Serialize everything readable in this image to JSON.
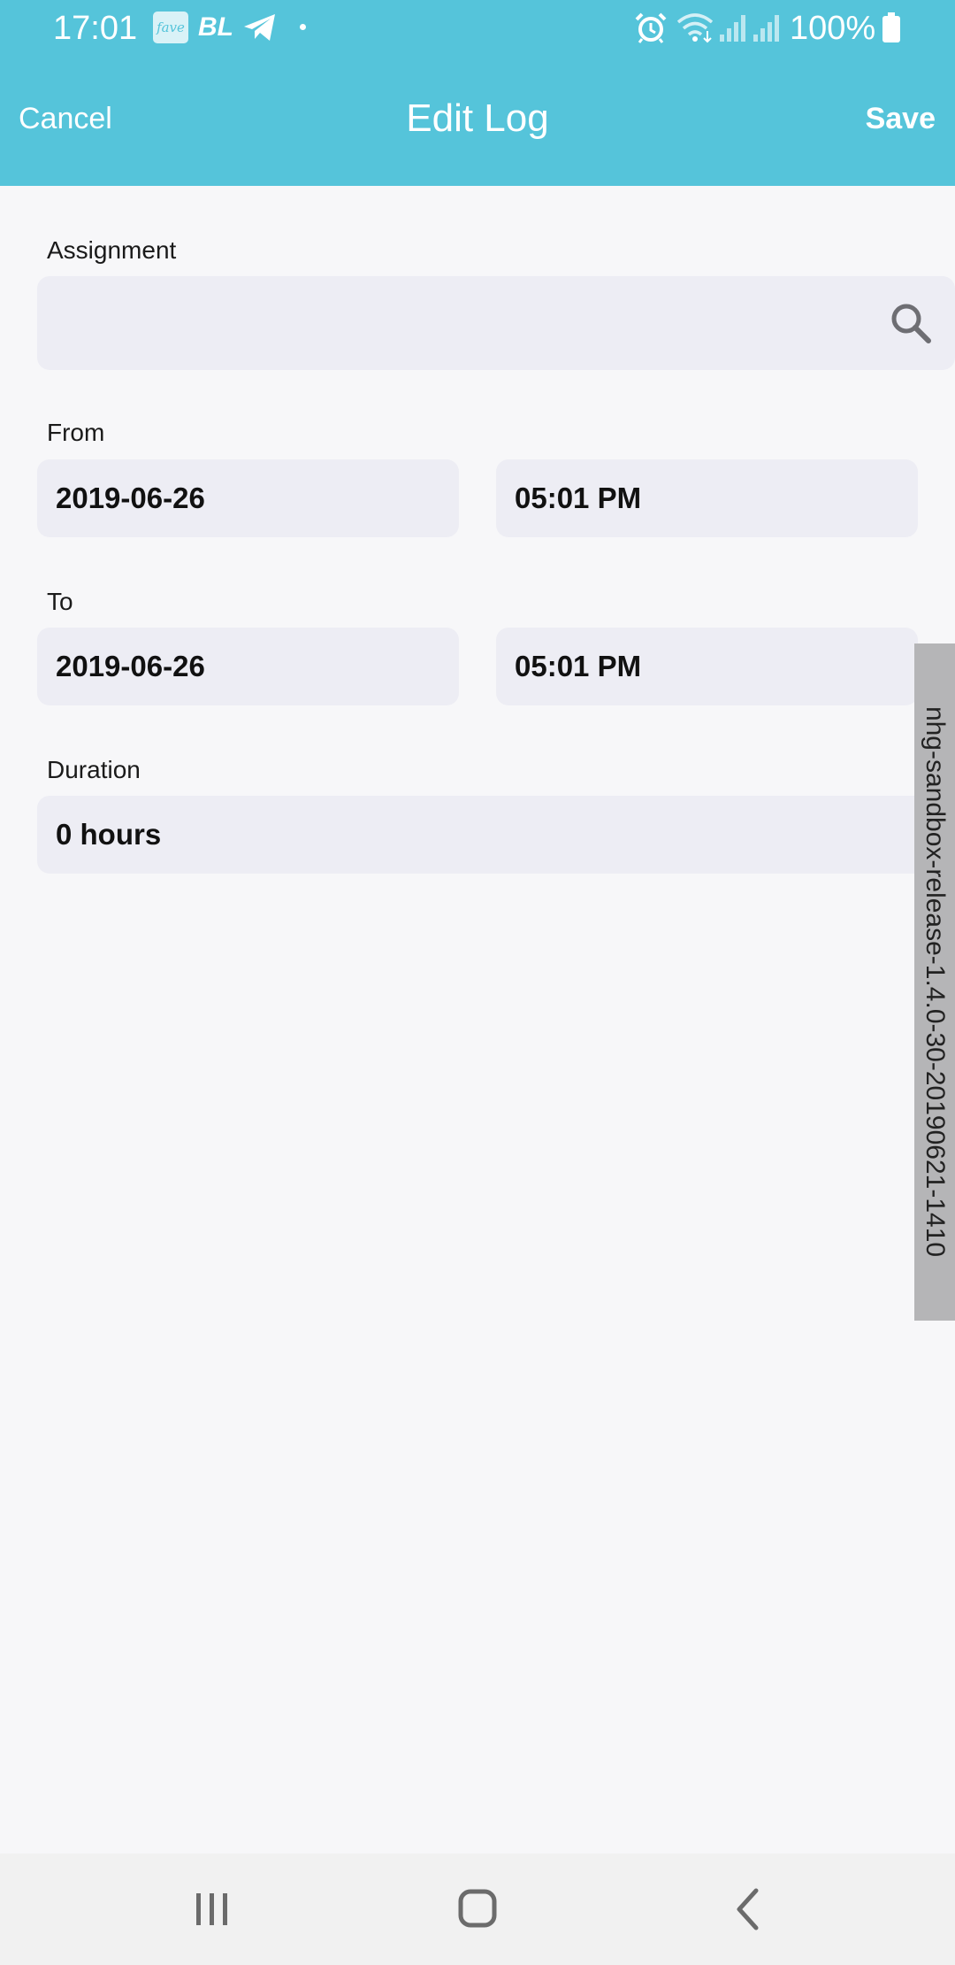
{
  "status_bar": {
    "time": "17:01",
    "fave_label": "fave",
    "bl_label": "BL",
    "battery_text": "100%",
    "icons": [
      "fave-icon",
      "bl-icon",
      "telegram-icon",
      "dot-icon",
      "alarm-icon",
      "wifi-icon",
      "signal-icon",
      "signal-icon",
      "battery-icon"
    ]
  },
  "app_bar": {
    "cancel_label": "Cancel",
    "title": "Edit Log",
    "save_label": "Save"
  },
  "form": {
    "assignment": {
      "label": "Assignment",
      "value": "",
      "placeholder": "",
      "icon": "search-icon"
    },
    "from": {
      "label": "From",
      "date": "2019-06-26",
      "time": "05:01 PM"
    },
    "to": {
      "label": "To",
      "date": "2019-06-26",
      "time": "05:01 PM"
    },
    "duration": {
      "label": "Duration",
      "value": "0 hours"
    }
  },
  "build_tag": "nhg-sandbox-release-1.4.0-30-20190621-1410",
  "nav_bar": {
    "buttons": [
      "recent-apps-icon",
      "home-icon",
      "back-icon"
    ]
  },
  "colors": {
    "header": "#55c4da",
    "background": "#f7f7f9",
    "field": "#ededf4",
    "nav_bar": "#f1f1f1"
  }
}
